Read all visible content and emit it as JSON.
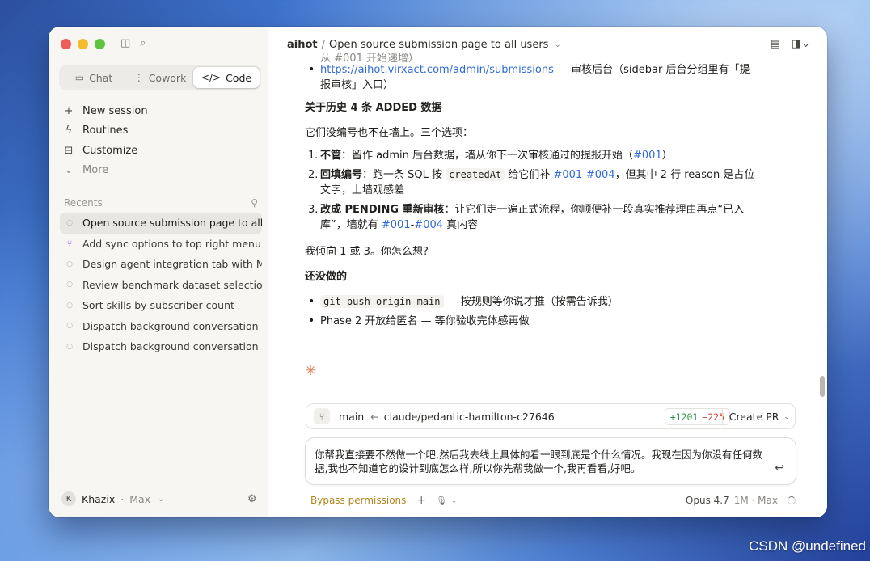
{
  "sidebar": {
    "tabs": [
      {
        "label": "Chat",
        "icon": "chat-bubble-icon"
      },
      {
        "label": "Cowork",
        "icon": "cowork-icon"
      },
      {
        "label": "Code",
        "icon": "code-brackets-icon",
        "active": true
      }
    ],
    "menu": [
      {
        "label": "New session",
        "icon": "plus-icon"
      },
      {
        "label": "Routines",
        "icon": "lightning-icon"
      },
      {
        "label": "Customize",
        "icon": "briefcase-icon"
      },
      {
        "label": "More",
        "icon": "chevron-down-icon"
      }
    ],
    "recents_title": "Recents",
    "recents": [
      {
        "label": "Open source submission page to all users",
        "active": true
      },
      {
        "label": "Add sync options to top right menu",
        "icon": "branch-icon"
      },
      {
        "label": "Design agent integration tab with MCP"
      },
      {
        "label": "Review benchmark dataset selection"
      },
      {
        "label": "Sort skills by subscriber count"
      },
      {
        "label": "Dispatch background conversation"
      },
      {
        "label": "Dispatch background conversation"
      }
    ],
    "user": {
      "avatar": "K",
      "name": "Khazix",
      "plan": "Max"
    }
  },
  "topbar": {
    "root": "aihot",
    "sep": "/",
    "title": "Open source submission page to all users"
  },
  "content": {
    "cut_line": "从 #001 开始递增）",
    "link_item": {
      "url": "https://aihot.virxact.com/admin/submissions",
      "text": " — 审核后台（sidebar 后台分组里有「提报审核」入口）"
    },
    "heading1": "关于历史 4 条 ADDED 数据",
    "para1": "它们没编号也不在墙上。三个选项：",
    "options": [
      {
        "num": "1.",
        "bold": "不管",
        "text1": "：留作 admin 后台数据，墙从你下一次审核通过的提报开始（",
        "link1": "#001",
        "text2": "）"
      },
      {
        "num": "2.",
        "bold": "回填编号",
        "text1": "：跑一条 SQL 按 ",
        "code": "createdAt",
        "text2": " 给它们补 ",
        "link1": "#001",
        "dash": "-",
        "link2": "#004",
        "text3": "，但其中 2 行 reason 是占位文字，上墙观感差"
      },
      {
        "num": "3.",
        "bold": "改成 PENDING 重新审核",
        "text1": "：让它们走一遍正式流程，你顺便补一段真实推荐理由再点“已入库”，墙就有 ",
        "link1": "#001",
        "dash": "-",
        "link2": "#004",
        "text2": " 真内容"
      }
    ],
    "para2": "我倾向 1 或 3。你怎么想?",
    "heading2": "还没做的",
    "todo": [
      {
        "code": "git push origin main",
        "text": " — 按规则等你说才推（按需告诉我）"
      },
      {
        "text": "Phase 2 开放给匿名 — 等你验收完体感再做"
      }
    ]
  },
  "branch_bar": {
    "base": "main",
    "arrow": "←",
    "branch": "claude/pedantic-hamilton-c27646",
    "additions": "+1201",
    "deletions": "−225",
    "create_pr": "Create PR"
  },
  "input": {
    "text": "你帮我直接要不然做一个吧,然后我去线上具体的看一眼到底是个什么情况。我现在因为你没有任何数据,我也不知道它的设计到底怎么样,所以你先帮我做一个,我再看看,好吧。"
  },
  "bottom_bar": {
    "permissions": "Bypass permissions",
    "model": "Opus 4.7",
    "context": "1M · Max"
  },
  "watermark": "CSDN @undefined"
}
